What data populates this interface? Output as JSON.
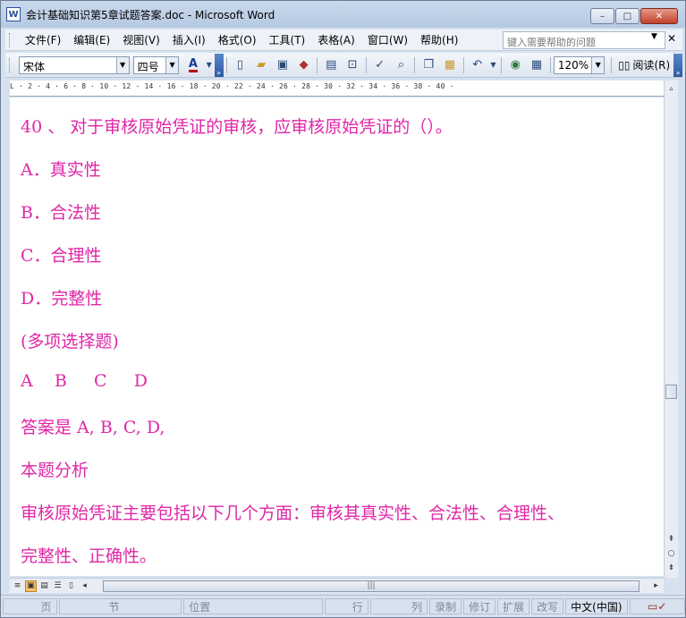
{
  "window": {
    "title": "会计基础知识第5章试题答案.doc - Microsoft Word",
    "app_icon": "W",
    "minimize": "–",
    "maximize": "□",
    "close": "✕"
  },
  "menubar": {
    "items": [
      "文件(F)",
      "编辑(E)",
      "视图(V)",
      "插入(I)",
      "格式(O)",
      "工具(T)",
      "表格(A)",
      "窗口(W)",
      "帮助(H)"
    ],
    "help_placeholder": "键入需要帮助的问题",
    "help_dropdown": "▼",
    "close_doc": "✕"
  },
  "toolbar": {
    "font": "宋体",
    "size": "四号",
    "zoom": "120%",
    "read_label": "阅读(R)",
    "font_color_letter": "A"
  },
  "ruler": {
    "ticks": "L  ·  2  ·  4  ·  6  ·  8  · 10  · 12  · 14  · 16  · 18  · 20  · 22  · 24  · 26  · 28  · 30  · 32  · 34  · 36  · 38  · 40  ·"
  },
  "document": {
    "paragraphs": [
      "40 、 对于审核原始凭证的审核，应审核原始凭证的（）。",
      "A．真实性",
      "B．合法性",
      "C．合理性",
      "D．完整性",
      "(多项选择题)",
      "A    B     C     D",
      "答案是 A, B, C, D,",
      "本题分析",
      "审核原始凭证主要包括以下几个方面：审核其真实性、合法性、合理性、",
      "完整性、正确性。"
    ]
  },
  "scrollbars": {
    "hscroll_grip": "|||"
  },
  "statusbar": {
    "page": "页",
    "section": "节",
    "position": "位置",
    "line": "行",
    "column": "列",
    "record": "录制",
    "track": "修订",
    "extend": "扩展",
    "overtype": "改写",
    "language": "中文(中国)"
  }
}
